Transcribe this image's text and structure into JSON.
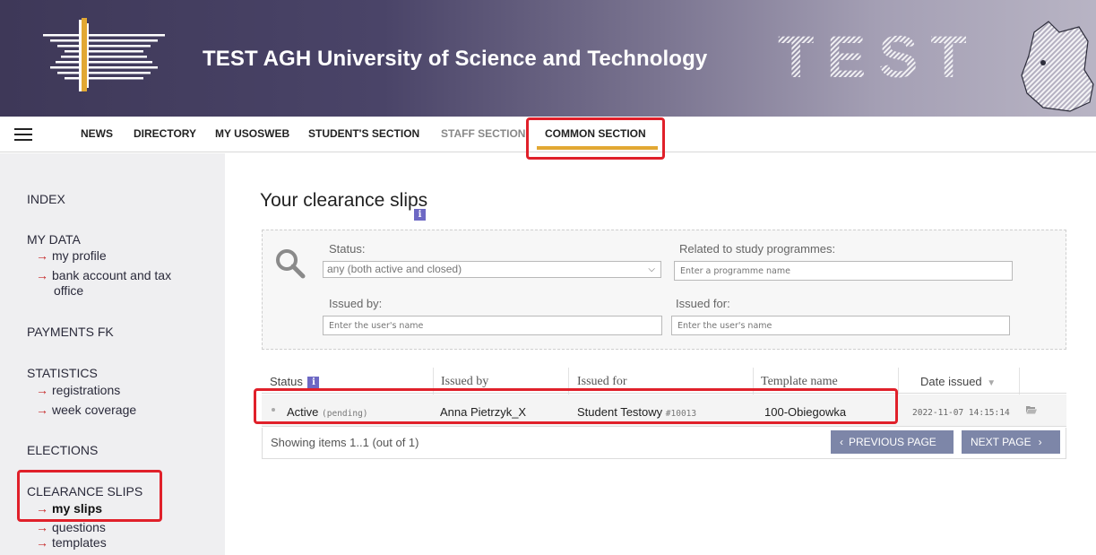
{
  "header": {
    "title": "TEST AGH University of Science and Technology",
    "watermark": "TEST"
  },
  "nav": {
    "items": [
      "News",
      "Directory",
      "My USOSweb",
      "Student's section",
      "Staff section",
      "Common section"
    ],
    "active": "Common section"
  },
  "sidebar": {
    "index": "INDEX",
    "my_data": {
      "heading": "MY DATA",
      "links": [
        "my profile",
        "bank account and tax",
        "office"
      ]
    },
    "payments": "PAYMENTS FK",
    "statistics": {
      "heading": "STATISTICS",
      "links": [
        "registrations",
        "week coverage"
      ]
    },
    "elections": "ELECTIONS",
    "clearance": {
      "heading": "CLEARANCE SLIPS",
      "links": [
        "my slips",
        "questions",
        "templates"
      ]
    }
  },
  "main": {
    "title": "Your clearance slips",
    "filters": {
      "status_label": "Status:",
      "status_value": "any (both active and closed)",
      "programmes_label": "Related to study programmes:",
      "programmes_placeholder": "Enter a programme name",
      "issued_by_label": "Issued by:",
      "issued_by_placeholder": "Enter the user's name",
      "issued_for_label": "Issued for:",
      "issued_for_placeholder": "Enter the user's name"
    },
    "table": {
      "headers": [
        "Status",
        "Issued by",
        "Issued for",
        "Template name",
        "Date issued"
      ],
      "rows": [
        {
          "status": "Active",
          "status_note": "(pending)",
          "issued_by": "Anna Pietrzyk_X",
          "issued_for": "Student Testowy",
          "issued_for_id": "#10013",
          "template": "100-Obiegowka",
          "date": "2022-11-07 14:15:14"
        }
      ]
    },
    "pagination": {
      "showing": "Showing items 1..1 (out of 1)",
      "prev": "Previous page",
      "next": "Next page"
    }
  },
  "colors": {
    "accent_underline": "#e2a833",
    "highlight": "#e0202a",
    "button": "#7d86a8",
    "info": "#6d68c4"
  }
}
